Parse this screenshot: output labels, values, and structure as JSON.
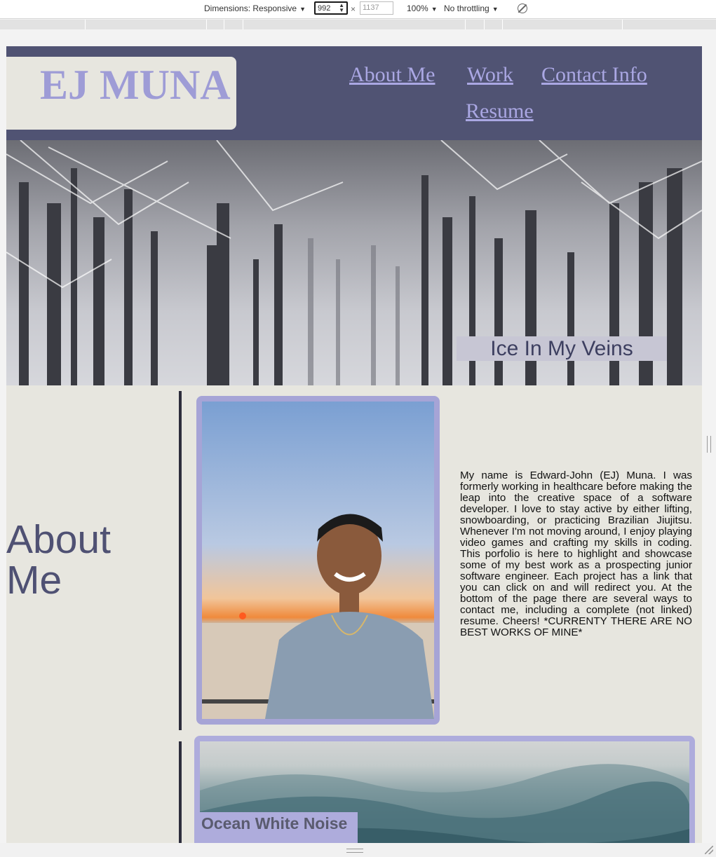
{
  "devtools": {
    "dimensions_label": "Dimensions: Responsive",
    "width_value": "992",
    "height_placeholder": "1137",
    "times": "×",
    "zoom": "100%",
    "throttling": "No throttling"
  },
  "site": {
    "logo": "EJ MUNA",
    "nav": {
      "about": "About Me",
      "work": "Work",
      "contact": "Contact Info",
      "resume": "Resume"
    },
    "hero_caption": "Ice In My Veins",
    "about": {
      "title_line1": "About",
      "title_line2": "Me",
      "text": "My name is Edward-John (EJ) Muna. I was formerly working in healthcare before making the leap into the creative space of a software developer. I love to stay active by either lifting, snowboarding, or practicing Brazilian Jiujitsu. Whenever I'm not moving around, I enjoy playing video games and crafting my skills in coding. This porfolio is here to highlight and showcase some of my best work as a prospecting junior software engineer. Each project has a link that you can click on and will redirect you. At the bottom of the page there are several ways to contact me, including a complete (not linked) resume. Cheers! *CURRENTY THERE ARE NO BEST WORKS OF MINE*"
    },
    "work": {
      "card_title": "Ocean White Noise"
    }
  },
  "colors": {
    "header_bg": "#505373",
    "page_bg": "#e7e6df",
    "accent": "#a6a4d6",
    "logo": "#9e9cd6"
  }
}
